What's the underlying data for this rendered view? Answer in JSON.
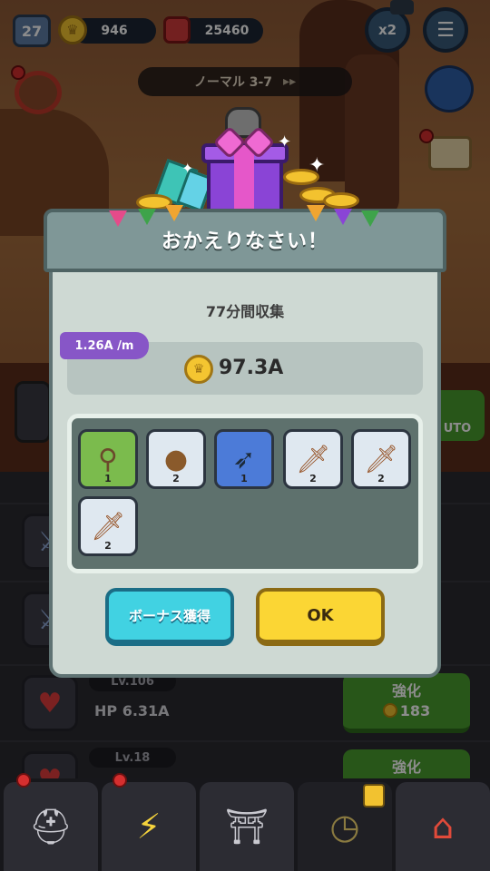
{
  "hud": {
    "player_level": "27",
    "coins": "946",
    "gems": "25460",
    "speed_label": "x2",
    "menu_icon": "hamburger-icon"
  },
  "stage": {
    "name": "ノーマル 3-7"
  },
  "dialog": {
    "title": "おかえりなさい！",
    "collect_label": "77分間収集",
    "rate_label": "1.26A /m",
    "coin_amount": "97.3A",
    "items": [
      {
        "icon": "mace-icon",
        "count": "1",
        "rarity": "green"
      },
      {
        "icon": "barrel-bomb-icon",
        "count": "2",
        "rarity": "white"
      },
      {
        "icon": "arrows-icon",
        "count": "1",
        "rarity": "blue"
      },
      {
        "icon": "wooden-sword-icon",
        "count": "2",
        "rarity": "white"
      },
      {
        "icon": "wooden-sword-icon",
        "count": "2",
        "rarity": "white"
      },
      {
        "icon": "wooden-sword-icon",
        "count": "2",
        "rarity": "white"
      }
    ],
    "bonus_button": "ボーナス獲得",
    "ok_button": "OK"
  },
  "upgrades": [
    {
      "level": "Lv.106",
      "stat": "HP 6.31A",
      "button": "強化",
      "cost": "183"
    },
    {
      "level": "Lv.18",
      "stat": "",
      "button": "強化",
      "cost": ""
    }
  ],
  "auto_label": "UTO",
  "nav": [
    "knight-helmet-icon",
    "lightning-compass-icon",
    "portal-gate-icon",
    "pocket-watch-icon",
    "shop-icon"
  ]
}
